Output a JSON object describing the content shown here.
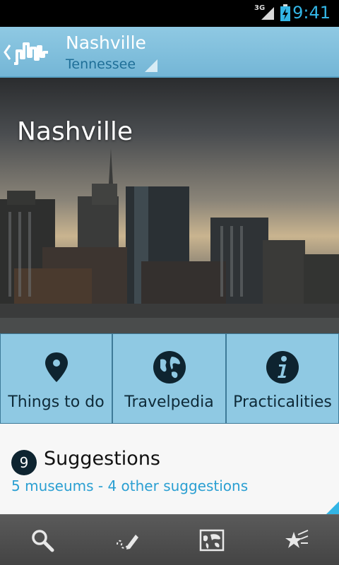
{
  "status_bar": {
    "network": "3G",
    "time": "9:41"
  },
  "action_bar": {
    "title": "Nashville",
    "subtitle": "Tennessee"
  },
  "hero": {
    "title": "Nashville"
  },
  "categories": [
    {
      "label": "Things to do",
      "icon": "map-pin-icon"
    },
    {
      "label": "Travelpedia",
      "icon": "globe-icon"
    },
    {
      "label": "Practicalities",
      "icon": "info-icon"
    }
  ],
  "suggestions": {
    "count": "9",
    "title": "Suggestions",
    "summary": "5 museums - 4 other suggestions"
  },
  "bottom_tabs": [
    {
      "icon": "search-icon"
    },
    {
      "icon": "pencil-icon"
    },
    {
      "icon": "map-icon"
    },
    {
      "icon": "favorites-icon"
    }
  ],
  "colors": {
    "accent": "#33b5e5",
    "action_bar": "#8fc9e3",
    "subtitle": "#1f6f98",
    "link": "#2a9fd2"
  }
}
